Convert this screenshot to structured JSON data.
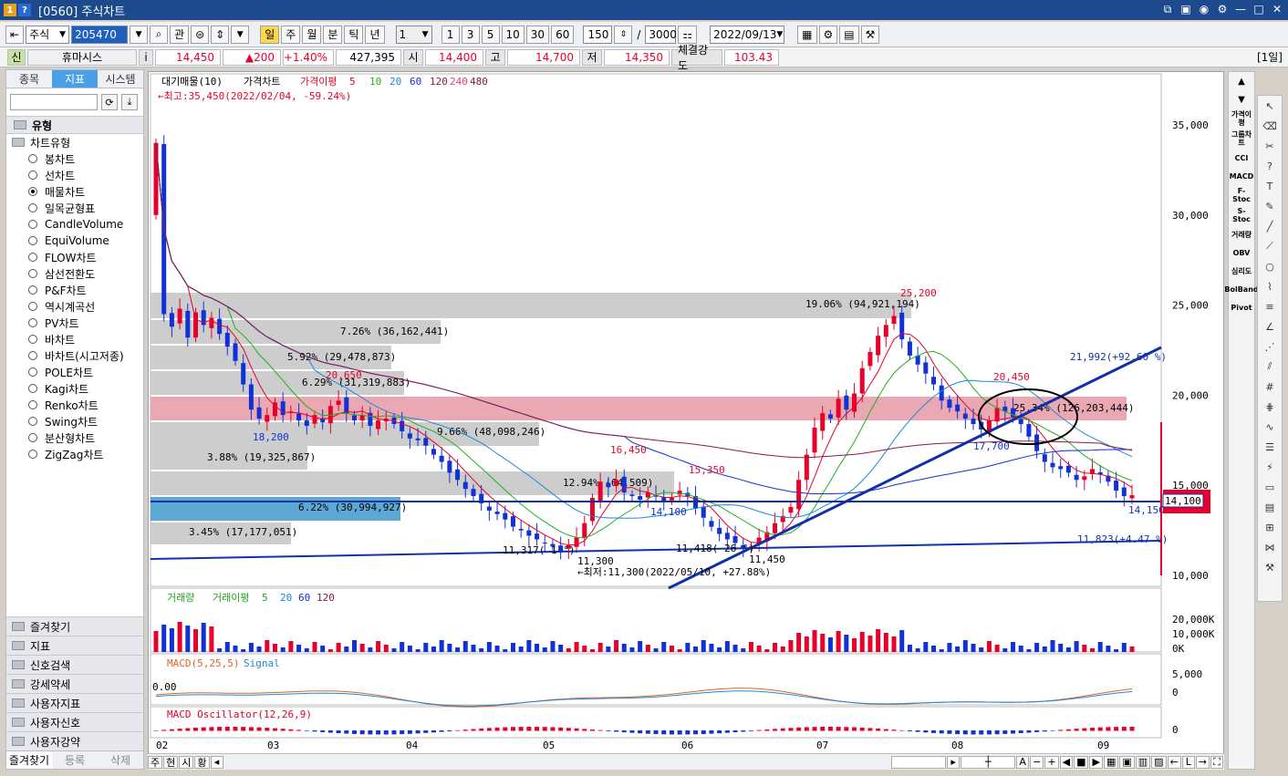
{
  "window": {
    "title": "[0560] 주식차트",
    "logo1": "1",
    "logo2": "?"
  },
  "toolbar": {
    "market": "주식",
    "code": "205470",
    "btn_gwan": "관",
    "periods": [
      "일",
      "주",
      "월",
      "분",
      "틱",
      "년"
    ],
    "interval_select": "1",
    "intervals": [
      "1",
      "3",
      "5",
      "10",
      "30",
      "60"
    ],
    "count": "150",
    "slash": "/",
    "total": "3000",
    "date": "2022/09/13"
  },
  "quote": {
    "flag": "신",
    "name": "휴마시스",
    "info": "i",
    "price": "14,450",
    "change": "▲200",
    "change_pct": "+1.40%",
    "volume": "427,395",
    "open_label": "시",
    "open": "14,400",
    "high_label": "고",
    "high": "14,700",
    "low_label": "저",
    "low": "14,350",
    "strength_label": "체결강도",
    "strength": "103.43",
    "period_badge": "[1일]"
  },
  "sidebar": {
    "tabs": [
      "종목",
      "지표",
      "시스템"
    ],
    "section": "유형",
    "root": "차트유형",
    "items": [
      "봉차트",
      "선차트",
      "매물차트",
      "일목균형표",
      "CandleVolume",
      "EquiVolume",
      "FLOW차트",
      "삼선전환도",
      "P&F차트",
      "역시계곡선",
      "PV차트",
      "바차트",
      "바차트(시고저종)",
      "POLE차트",
      "Kagi차트",
      "Renko차트",
      "Swing차트",
      "분산형차트",
      "ZigZag차트"
    ],
    "selected": "매물차트",
    "bottom": [
      "즐겨찾기",
      "지표",
      "신호검색",
      "강세약세",
      "사용자지표",
      "사용자신호",
      "사용자강약"
    ],
    "bottom_tabs": [
      "즐겨찾기",
      "등록",
      "삭제"
    ]
  },
  "chart": {
    "legend": {
      "vol_profile": "대기매물(10)",
      "price": "가격차트",
      "ma_label": "가격이평",
      "ma_periods": [
        "5",
        "10",
        "20",
        "60",
        "120",
        "240",
        "480"
      ]
    },
    "max_note": "←최고:35,450(2022/02/04, -59.24%)",
    "min_note": "←최저:11,300(2022/05/10, +27.88%)",
    "y_ticks": [
      "35,000",
      "30,000",
      "25,000",
      "20,000",
      "15,000",
      "10,000"
    ],
    "x_ticks": [
      "02",
      "03",
      "04",
      "05",
      "06",
      "07",
      "08",
      "09"
    ],
    "profile_labels": [
      "19.06% (94,921,194)",
      "7.26% (36,162,441)",
      "5.92% (29,478,873)",
      "6.29% (31,319,883)",
      "25.34% (126,203,444)",
      "9.66% (48,098,246)",
      "3.88% (19,325,867)",
      "12.94% (64,509)",
      "6.22% (30,994,927)",
      "3.45% (17,177,051)"
    ],
    "price_labels": [
      "25,200",
      "20,650",
      "18,200",
      "20,450",
      "17,700",
      "16,450",
      "15,350",
      "14,100",
      "11,300",
      "11,450",
      "14,150"
    ],
    "trend_labels": [
      "21,992(+92.60 %)",
      "11,823(+4.47 %)",
      "11,317( 1 °)",
      "11,418( 26 °)"
    ],
    "current_price": "14,450",
    "cursor_price": "14,100",
    "volume_panel": {
      "title": "거래량",
      "ma_label": "거래이평",
      "ma": [
        "5",
        "20",
        "60",
        "120"
      ],
      "ticks": [
        "20,000K",
        "10,000K",
        "0K"
      ]
    },
    "macd_panel": {
      "title": "MACD(5,25,5)",
      "signal": "Signal",
      "zero": "0.00",
      "ticks": [
        "5,000",
        "0"
      ]
    },
    "osc_panel": {
      "title": "MACD Oscillator(12,26,9)",
      "ticks": [
        "0"
      ]
    }
  },
  "right_tools": [
    "가격이평",
    "그룹차트",
    "CCI",
    "MACD",
    "F-Stoc",
    "S-Stoc",
    "거래량",
    "OBV",
    "심리도",
    "BolBand",
    "Pivot"
  ],
  "bottom_bar": {
    "tabs": [
      "주",
      "현",
      "시",
      "황"
    ]
  },
  "colors": {
    "up": "#e8002a",
    "down": "#1030d8",
    "profile": "#c8c8c8",
    "profile_hi": "#e89aa8",
    "profile_blue": "#4aa0d0"
  }
}
